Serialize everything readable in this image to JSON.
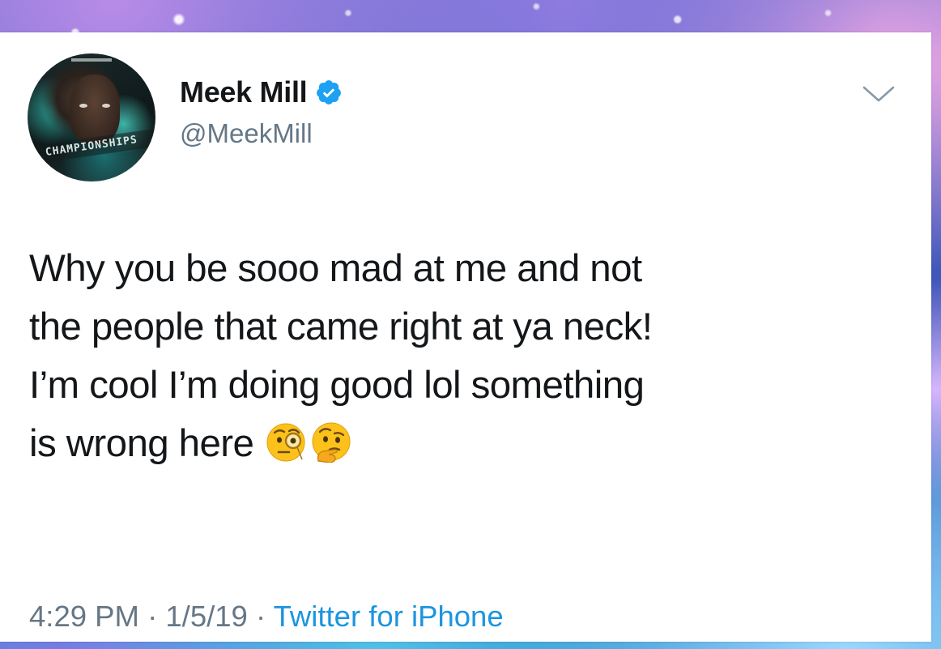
{
  "tweet": {
    "display_name": "Meek Mill",
    "handle": "@MeekMill",
    "verified_icon": "verified-badge-icon",
    "menu_icon": "chevron-down-icon",
    "avatar_caption": "CHAMPIONSHIPS",
    "text_lines": [
      "Why you be sooo mad at me and not",
      "the people that came right at ya neck!",
      "I’m cool I’m doing good  lol something",
      "is wrong here"
    ],
    "emojis": [
      "face-with-monocle",
      "thinking-face"
    ],
    "time": "4:29 PM",
    "separator": " · ",
    "date": "1/5/19",
    "source": "Twitter for iPhone"
  },
  "colors": {
    "text": "#14171a",
    "secondary": "#657786",
    "link": "#1b95e0",
    "verified": "#1da1f2"
  }
}
